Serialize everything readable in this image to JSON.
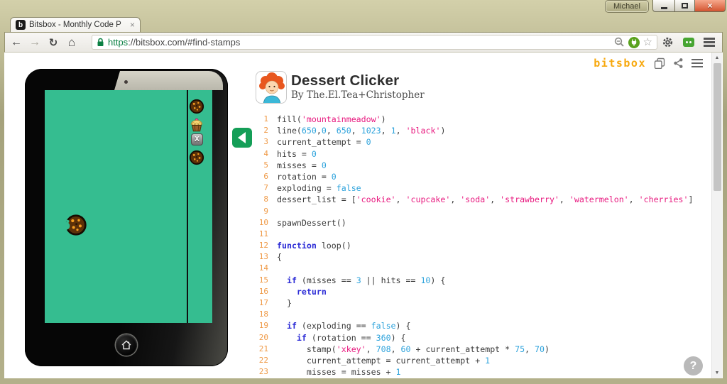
{
  "browser": {
    "profile": "Michael",
    "tab_title": "Bitsbox - Monthly Code P",
    "url_scheme": "https",
    "url_rest": "://bitsbox.com/#find-stamps",
    "url_full": "https://bitsbox.com/#find-stamps"
  },
  "header": {
    "logo": "bitsbox",
    "app_title": "Dessert Clicker",
    "byline": "By The.El.Tea+Christopher"
  },
  "icons": {
    "favicon_letter": "b",
    "tab_close": "×",
    "close_x": "×",
    "back": "←",
    "forward": "→",
    "reload": "↻",
    "home": "⌂",
    "star": "☆",
    "scroll_up": "▲",
    "scroll_down": "▼",
    "help": "?"
  },
  "game": {
    "sidebar_stamps": [
      "cookie",
      "cupcake",
      "xkey",
      "cookie"
    ],
    "xkey_label": "X",
    "play_area_stamp": "cookie-bitten"
  },
  "colors": {
    "screen_teal": "#35bd90",
    "accent_green": "#149e57",
    "logo_orange": "#f7a80d",
    "gutter_orange": "#ef9a47",
    "num_blue": "#2ea3dc",
    "string_pink": "#e8197f",
    "keyword_blue": "#2b2bd6"
  },
  "code": {
    "lines": [
      {
        "n": 1,
        "t": [
          [
            "p",
            "fill("
          ],
          [
            "s",
            "'mountainmeadow'"
          ],
          [
            "p",
            ")"
          ]
        ]
      },
      {
        "n": 2,
        "t": [
          [
            "p",
            "line("
          ],
          [
            "n",
            "650"
          ],
          [
            "p",
            ","
          ],
          [
            "n",
            "0"
          ],
          [
            "p",
            ", "
          ],
          [
            "n",
            "650"
          ],
          [
            "p",
            ", "
          ],
          [
            "n",
            "1023"
          ],
          [
            "p",
            ", "
          ],
          [
            "n",
            "1"
          ],
          [
            "p",
            ", "
          ],
          [
            "s",
            "'black'"
          ],
          [
            "p",
            ")"
          ]
        ]
      },
      {
        "n": 3,
        "t": [
          [
            "p",
            "current_attempt = "
          ],
          [
            "n",
            "0"
          ]
        ]
      },
      {
        "n": 4,
        "t": [
          [
            "p",
            "hits = "
          ],
          [
            "n",
            "0"
          ]
        ]
      },
      {
        "n": 5,
        "t": [
          [
            "p",
            "misses = "
          ],
          [
            "n",
            "0"
          ]
        ]
      },
      {
        "n": 6,
        "t": [
          [
            "p",
            "rotation = "
          ],
          [
            "n",
            "0"
          ]
        ]
      },
      {
        "n": 7,
        "t": [
          [
            "p",
            "exploding = "
          ],
          [
            "b",
            "false"
          ]
        ]
      },
      {
        "n": 8,
        "t": [
          [
            "p",
            "dessert_list = ["
          ],
          [
            "s",
            "'cookie'"
          ],
          [
            "p",
            ", "
          ],
          [
            "s",
            "'cupcake'"
          ],
          [
            "p",
            ", "
          ],
          [
            "s",
            "'soda'"
          ],
          [
            "p",
            ", "
          ],
          [
            "s",
            "'strawberry'"
          ],
          [
            "p",
            ", "
          ],
          [
            "s",
            "'watermelon'"
          ],
          [
            "p",
            ", "
          ],
          [
            "s",
            "'cherries'"
          ],
          [
            "p",
            "]"
          ]
        ]
      },
      {
        "n": 9,
        "t": []
      },
      {
        "n": 10,
        "t": [
          [
            "p",
            "spawnDessert()"
          ]
        ]
      },
      {
        "n": 11,
        "t": []
      },
      {
        "n": 12,
        "t": [
          [
            "k",
            "function"
          ],
          [
            "p",
            " loop()"
          ]
        ]
      },
      {
        "n": 13,
        "t": [
          [
            "p",
            "{"
          ]
        ]
      },
      {
        "n": 14,
        "t": []
      },
      {
        "n": 15,
        "t": [
          [
            "p",
            "  "
          ],
          [
            "k",
            "if"
          ],
          [
            "p",
            " (misses == "
          ],
          [
            "n",
            "3"
          ],
          [
            "p",
            " || hits == "
          ],
          [
            "n",
            "10"
          ],
          [
            "p",
            ") {"
          ]
        ]
      },
      {
        "n": 16,
        "t": [
          [
            "p",
            "    "
          ],
          [
            "k",
            "return"
          ]
        ]
      },
      {
        "n": 17,
        "t": [
          [
            "p",
            "  }"
          ]
        ]
      },
      {
        "n": 18,
        "t": []
      },
      {
        "n": 19,
        "t": [
          [
            "p",
            "  "
          ],
          [
            "k",
            "if"
          ],
          [
            "p",
            " (exploding == "
          ],
          [
            "b",
            "false"
          ],
          [
            "p",
            ") {"
          ]
        ]
      },
      {
        "n": 20,
        "t": [
          [
            "p",
            "    "
          ],
          [
            "k",
            "if"
          ],
          [
            "p",
            " (rotation == "
          ],
          [
            "n",
            "360"
          ],
          [
            "p",
            ") {"
          ]
        ]
      },
      {
        "n": 21,
        "t": [
          [
            "p",
            "      stamp("
          ],
          [
            "s",
            "'xkey'"
          ],
          [
            "p",
            ", "
          ],
          [
            "n",
            "708"
          ],
          [
            "p",
            ", "
          ],
          [
            "n",
            "60"
          ],
          [
            "p",
            " + current_attempt * "
          ],
          [
            "n",
            "75"
          ],
          [
            "p",
            ", "
          ],
          [
            "n",
            "70"
          ],
          [
            "p",
            ")"
          ]
        ]
      },
      {
        "n": 22,
        "t": [
          [
            "p",
            "      current_attempt = current_attempt + "
          ],
          [
            "n",
            "1"
          ]
        ]
      },
      {
        "n": 23,
        "t": [
          [
            "p",
            "      misses = misses + "
          ],
          [
            "n",
            "1"
          ]
        ]
      }
    ]
  }
}
